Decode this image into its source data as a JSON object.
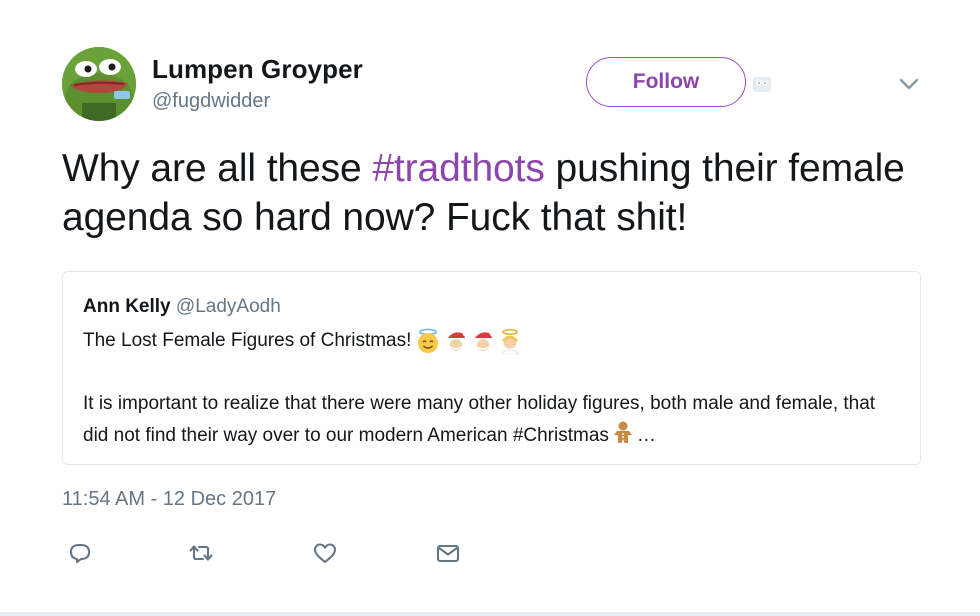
{
  "tweet": {
    "author": {
      "display_name": "Lumpen Groyper",
      "handle": "@fugdwidder",
      "avatar_icon": "frog-avatar-icon"
    },
    "follow_label": "Follow",
    "text_before": "Why are all these ",
    "hashtag": "#tradthots",
    "text_after": " pushing their female agenda so hard now? Fuck that shit!",
    "timestamp": "11:54 AM - 12 Dec 2017",
    "accent_color": "#8e44ad"
  },
  "quoted_tweet": {
    "name": "Ann Kelly",
    "handle": "@LadyAodh",
    "line1": "The Lost Female Figures of Christmas!",
    "line1_emojis": [
      "smiling-face-with-halo-emoji",
      "santa-claus-emoji",
      "santa-claus-emoji",
      "angel-emoji"
    ],
    "body": "It is important to realize that there were many other holiday figures, both male and female, that did not find their way over to our modern American #Christmas",
    "body_emoji": "gingerbread-emoji",
    "ellipsis": "…"
  },
  "actions": [
    {
      "name": "reply-icon"
    },
    {
      "name": "retweet-icon"
    },
    {
      "name": "like-icon"
    },
    {
      "name": "direct-message-icon"
    }
  ]
}
